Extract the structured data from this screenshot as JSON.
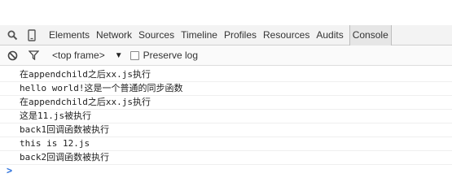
{
  "toolbar": {
    "tabs": [
      {
        "label": "Elements"
      },
      {
        "label": "Network"
      },
      {
        "label": "Sources"
      },
      {
        "label": "Timeline"
      },
      {
        "label": "Profiles"
      },
      {
        "label": "Resources"
      },
      {
        "label": "Audits"
      },
      {
        "label": "Console",
        "active": true
      }
    ]
  },
  "filter": {
    "frame_selector": "<top frame>",
    "preserve_log_label": "Preserve log",
    "preserve_log_checked": false
  },
  "console": {
    "lines": [
      "在appendchild之后xx.js执行",
      "hello world!这是一个普通的同步函数",
      "在appendchild之后xx.js执行",
      "这是11.js被执行",
      "back1回调函数被执行",
      "this is 12.js",
      "back2回调函数被执行"
    ],
    "prompt_symbol": ">"
  },
  "colors": {
    "toolbar_bg": "#f3f3f3",
    "prompt_color": "#2a6fdb"
  },
  "icons": [
    "search-icon",
    "device-mode-icon",
    "clear-console-icon",
    "filter-icon",
    "dropdown-arrow-icon",
    "prompt-chevron-icon"
  ]
}
